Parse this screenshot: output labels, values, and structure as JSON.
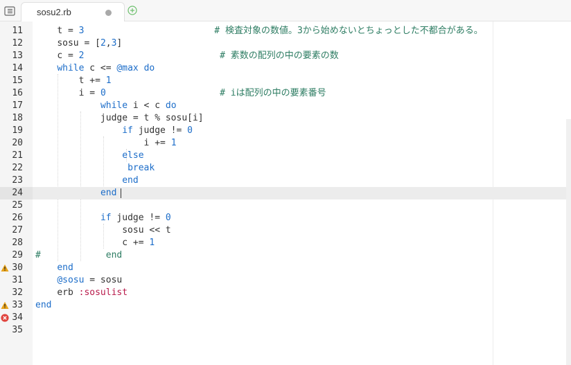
{
  "tab": {
    "title": "sosu2.rb"
  },
  "lines": [
    {
      "n": "11",
      "tokens": [
        [
          "t = ",
          ""
        ],
        [
          "3",
          "n"
        ],
        [
          "                        ",
          ""
        ],
        [
          "# 検査対象の数値。3から始めないとちょっとした不都合がある。",
          "c"
        ]
      ]
    },
    {
      "n": "12",
      "tokens": [
        [
          "sosu = [",
          ""
        ],
        [
          "2",
          "n"
        ],
        [
          ",",
          ""
        ],
        [
          "3",
          "n"
        ],
        [
          "]",
          ""
        ]
      ]
    },
    {
      "n": "13",
      "tokens": [
        [
          "c = ",
          ""
        ],
        [
          "2",
          "n"
        ],
        [
          "                         ",
          ""
        ],
        [
          "# 素数の配列の中の要素の数",
          "c"
        ]
      ]
    },
    {
      "n": "14",
      "tokens": [
        [
          "while",
          "k"
        ],
        [
          " c <= ",
          ""
        ],
        [
          "@max",
          "iv"
        ],
        [
          " ",
          ""
        ],
        [
          "do",
          "k"
        ]
      ]
    },
    {
      "n": "15",
      "tokens": [
        [
          "    t += ",
          ""
        ],
        [
          "1",
          "n"
        ]
      ]
    },
    {
      "n": "16",
      "tokens": [
        [
          "    i = ",
          ""
        ],
        [
          "0",
          "n"
        ],
        [
          "                     ",
          ""
        ],
        [
          "# iは配列の中の要素番号",
          "c"
        ]
      ]
    },
    {
      "n": "17",
      "tokens": [
        [
          "        ",
          ""
        ],
        [
          "while",
          "k"
        ],
        [
          " i < c ",
          ""
        ],
        [
          "do",
          "k"
        ]
      ]
    },
    {
      "n": "18",
      "tokens": [
        [
          "        judge = t % sosu[i]",
          ""
        ]
      ]
    },
    {
      "n": "19",
      "tokens": [
        [
          "            ",
          ""
        ],
        [
          "if",
          "k"
        ],
        [
          " judge != ",
          ""
        ],
        [
          "0",
          "n"
        ]
      ]
    },
    {
      "n": "20",
      "tokens": [
        [
          "                i += ",
          ""
        ],
        [
          "1",
          "n"
        ]
      ]
    },
    {
      "n": "21",
      "tokens": [
        [
          "            ",
          ""
        ],
        [
          "else",
          "k"
        ]
      ]
    },
    {
      "n": "22",
      "tokens": [
        [
          "             ",
          ""
        ],
        [
          "break",
          "k"
        ]
      ]
    },
    {
      "n": "23",
      "tokens": [
        [
          "            ",
          ""
        ],
        [
          "end",
          "k"
        ]
      ]
    },
    {
      "n": "24",
      "tokens": [
        [
          "        ",
          ""
        ],
        [
          "end",
          "k"
        ]
      ]
    },
    {
      "n": "25",
      "tokens": []
    },
    {
      "n": "26",
      "tokens": [
        [
          "        ",
          ""
        ],
        [
          "if",
          "k"
        ],
        [
          " judge != ",
          ""
        ],
        [
          "0",
          "n"
        ]
      ]
    },
    {
      "n": "27",
      "tokens": [
        [
          "            sosu << t",
          ""
        ]
      ]
    },
    {
      "n": "28",
      "tokens": [
        [
          "            c += ",
          ""
        ],
        [
          "1",
          "n"
        ]
      ]
    },
    {
      "n": "29",
      "tokens": [
        [
          "#",
          "c"
        ],
        [
          "            ",
          ""
        ],
        [
          "end",
          "c"
        ]
      ]
    },
    {
      "n": "30",
      "tokens": [
        [
          "end",
          "k"
        ]
      ]
    },
    {
      "n": "31",
      "tokens": [
        [
          "@sosu",
          "iv"
        ],
        [
          " = sosu",
          ""
        ]
      ]
    },
    {
      "n": "32",
      "tokens": [
        [
          "erb ",
          ""
        ],
        [
          ":sosulist",
          "s"
        ]
      ]
    },
    {
      "n": "33",
      "tokens": [
        [
          "end",
          "k"
        ]
      ]
    },
    {
      "n": "34",
      "tokens": []
    },
    {
      "n": "35",
      "tokens": []
    }
  ],
  "markers": [
    {
      "line": "30",
      "kind": "warning-icon"
    },
    {
      "line": "33",
      "kind": "warning-icon"
    },
    {
      "line": "34",
      "kind": "error-icon"
    }
  ],
  "current_line": "24",
  "colors": {
    "keyword": "#1c6dc9",
    "number": "#1c6dc9",
    "symbol": "#b8194a",
    "comment": "#2e7d63",
    "warning": "#e8a31a",
    "error": "#e0443e"
  }
}
